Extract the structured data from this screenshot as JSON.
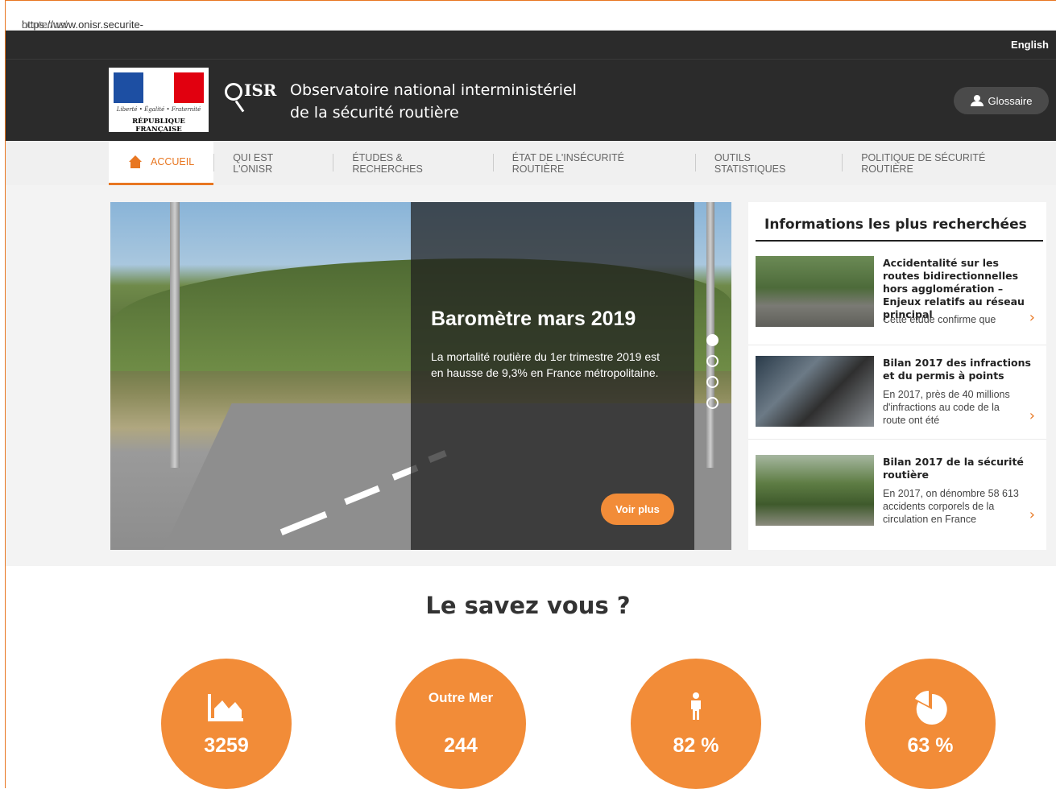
{
  "browser": {
    "url_host": "https://www.onisr.securite-routiere.interieur.gouv.fr/",
    "url_path": "contenus/"
  },
  "topbar": {
    "language_link": "English"
  },
  "header": {
    "republic_motto": "Liberté • Égalité • Fraternité",
    "republic_name": "RÉPUBLIQUE FRANÇAISE",
    "site_mark": "ISR",
    "site_title_line1": "Observatoire national interministériel",
    "site_title_line2": "de la sécurité routière",
    "glossary_button": "Glossaire"
  },
  "nav": {
    "items": [
      {
        "label": "ACCUEIL",
        "active": true
      },
      {
        "label": "QUI EST L'ONISR"
      },
      {
        "label": "ÉTUDES & RECHERCHES"
      },
      {
        "label": "ÉTAT DE L'INSÉCURITÉ ROUTIÈRE"
      },
      {
        "label": "OUTILS STATISTIQUES"
      },
      {
        "label": "POLITIQUE DE SÉCURITÉ ROUTIÈRE"
      }
    ]
  },
  "slider": {
    "title": "Baromètre mars 2019",
    "text": "La mortalité routière du 1er trimestre 2019 est en hausse de 9,3% en France métropolitaine.",
    "button": "Voir plus",
    "slides_count": 4,
    "active_slide": 1
  },
  "panel": {
    "heading": "Informations les plus recherchées",
    "items": [
      {
        "title": "Accidentalité sur les routes bidirectionnelles hors agglomération – Enjeux relatifs au réseau principal",
        "excerpt": "Cette étude confirme que"
      },
      {
        "title": "Bilan 2017 des infractions et du permis à points",
        "excerpt": "En 2017, près de 40 millions d'infractions au code de la route ont été"
      },
      {
        "title": "Bilan 2017 de la sécurité routière",
        "excerpt": "En 2017, on dénombre 58 613 accidents corporels de la circulation en France"
      }
    ]
  },
  "facts": {
    "heading": "Le savez vous ?",
    "items": [
      {
        "icon": "area-chart-icon",
        "label": "",
        "value": "3259"
      },
      {
        "icon": "",
        "label": "Outre Mer",
        "value": "244"
      },
      {
        "icon": "person-icon",
        "label": "",
        "value": "82 %"
      },
      {
        "icon": "pie-chart-icon",
        "label": "",
        "value": "63 %"
      }
    ]
  },
  "colors": {
    "accent": "#f28c38",
    "dark": "#2b2b2b"
  }
}
